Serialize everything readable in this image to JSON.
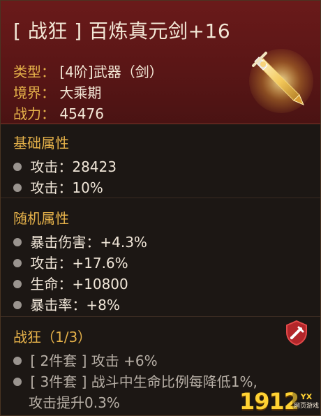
{
  "item": {
    "name": "[ 战狂 ] 百炼真元剑+16",
    "type_label": "类型：",
    "type_value": "[4阶]武器（剑）",
    "realm_label": "境界：",
    "realm_value": "大乘期",
    "power_label": "战力：",
    "power_value": "45476",
    "icon": "sword-icon"
  },
  "base_attrs": {
    "title": "基础属性",
    "rows": [
      {
        "text": "攻击：28423"
      },
      {
        "text": "攻击：10%"
      }
    ]
  },
  "random_attrs": {
    "title": "随机属性",
    "rows": [
      {
        "text": "暴击伤害：+4.3%"
      },
      {
        "text": "攻击：+17.6%"
      },
      {
        "text": "生命：+10800"
      },
      {
        "text": "暴击率：+8%"
      }
    ]
  },
  "set": {
    "title": "战狂（1/3）",
    "icon": "set-shield-icon",
    "rows": [
      {
        "text": "[ 2件套 ] 攻击 +6%"
      },
      {
        "text": "[ 3件套 ] 战斗中生命比例每降低1%,"
      },
      {
        "text": "攻击提升0.3%"
      }
    ]
  },
  "watermark": {
    "text": "1912",
    "small_text": "YX",
    "sub_text": "网页游戏"
  },
  "colors": {
    "header_bg": "#5a1616",
    "accent_gold": "#e6b24a",
    "text_light": "#f3e7d6",
    "text_muted": "#b7afa6",
    "card_bg": "#1c1714"
  }
}
